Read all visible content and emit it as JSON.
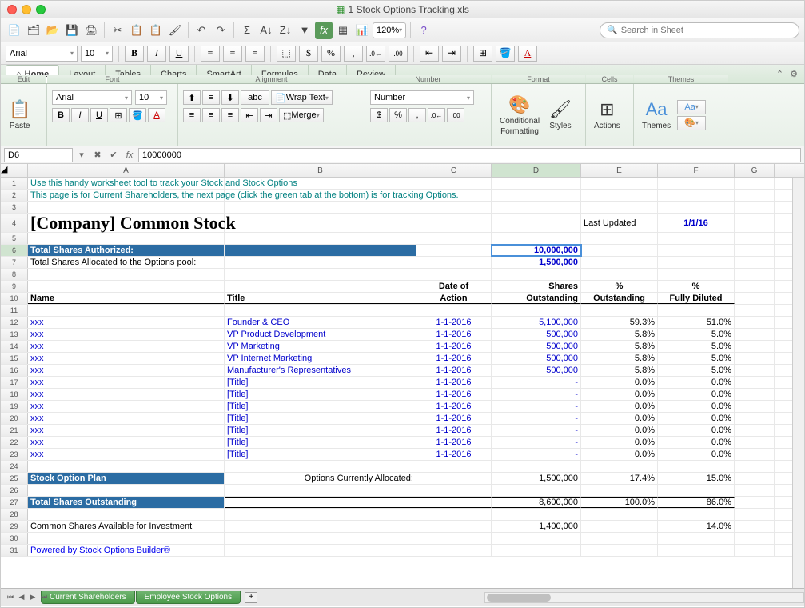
{
  "window": {
    "title": "1 Stock Options Tracking.xls"
  },
  "toolbar1": {
    "zoom": "120%",
    "search_placeholder": "Search in Sheet"
  },
  "toolbar2": {
    "font": "Arial",
    "size": "10"
  },
  "ribbon": {
    "tabs": [
      "Home",
      "Layout",
      "Tables",
      "Charts",
      "SmartArt",
      "Formulas",
      "Data",
      "Review"
    ],
    "groups": {
      "edit": "Edit",
      "font": "Font",
      "alignment": "Alignment",
      "number": "Number",
      "format": "Format",
      "cells": "Cells",
      "themes": "Themes"
    },
    "font_name": "Arial",
    "font_size": "10",
    "wrap_text": "Wrap Text",
    "merge": "Merge",
    "number_format": "Number",
    "cond_fmt": "Conditional",
    "cond_fmt2": "Formatting",
    "styles": "Styles",
    "actions": "Actions",
    "themes_btn": "Themes",
    "aa": "Aa",
    "paste": "Paste"
  },
  "formula": {
    "cell_ref": "D6",
    "value": "10000000"
  },
  "cols": [
    "A",
    "B",
    "C",
    "D",
    "E",
    "F",
    "G"
  ],
  "sheets": {
    "active": "Current Shareholders",
    "other": "Employee Stock Options"
  },
  "cells": {
    "r1": "Use this handy worksheet tool to track your Stock and Stock Options",
    "r2": "This page is for Current Shareholders, the next page (click the green tab at the bottom) is for tracking Options.",
    "r4_title": "[Company] Common Stock",
    "r4_lu": "Last Updated",
    "r4_date": "1/1/16",
    "r6_a": "Total Shares Authorized:",
    "r6_d": "10,000,000",
    "r7_a": "Total Shares Allocated to the Options pool:",
    "r7_d": "1,500,000",
    "r9_c": "Date of",
    "r9_d": "Shares",
    "r9_e": "%",
    "r9_f": "%",
    "r10_a": "Name",
    "r10_b": "Title",
    "r10_c": "Action",
    "r10_d": "Outstanding",
    "r10_e": "Outstanding",
    "r10_f": "Fully Diluted",
    "rows": [
      {
        "a": "xxx",
        "b": "Founder & CEO",
        "c": "1-1-2016",
        "d": "5,100,000",
        "e": "59.3%",
        "f": "51.0%"
      },
      {
        "a": "xxx",
        "b": "VP Product Development",
        "c": "1-1-2016",
        "d": "500,000",
        "e": "5.8%",
        "f": "5.0%"
      },
      {
        "a": "xxx",
        "b": "VP Marketing",
        "c": "1-1-2016",
        "d": "500,000",
        "e": "5.8%",
        "f": "5.0%"
      },
      {
        "a": "xxx",
        "b": "VP Internet Marketing",
        "c": "1-1-2016",
        "d": "500,000",
        "e": "5.8%",
        "f": "5.0%"
      },
      {
        "a": "xxx",
        "b": "Manufacturer's Representatives",
        "c": "1-1-2016",
        "d": "500,000",
        "e": "5.8%",
        "f": "5.0%"
      },
      {
        "a": "xxx",
        "b": "[Title]",
        "c": "1-1-2016",
        "d": "-",
        "e": "0.0%",
        "f": "0.0%"
      },
      {
        "a": "xxx",
        "b": "[Title]",
        "c": "1-1-2016",
        "d": "-",
        "e": "0.0%",
        "f": "0.0%"
      },
      {
        "a": "xxx",
        "b": "[Title]",
        "c": "1-1-2016",
        "d": "-",
        "e": "0.0%",
        "f": "0.0%"
      },
      {
        "a": "xxx",
        "b": "[Title]",
        "c": "1-1-2016",
        "d": "-",
        "e": "0.0%",
        "f": "0.0%"
      },
      {
        "a": "xxx",
        "b": "[Title]",
        "c": "1-1-2016",
        "d": "-",
        "e": "0.0%",
        "f": "0.0%"
      },
      {
        "a": "xxx",
        "b": "[Title]",
        "c": "1-1-2016",
        "d": "-",
        "e": "0.0%",
        "f": "0.0%"
      },
      {
        "a": "xxx",
        "b": "[Title]",
        "c": "1-1-2016",
        "d": "-",
        "e": "0.0%",
        "f": "0.0%"
      }
    ],
    "r25_a": "Stock Option Plan",
    "r25_b": "Options Currently Allocated:",
    "r25_d": "1,500,000",
    "r25_e": "17.4%",
    "r25_f": "15.0%",
    "r27_a": "Total Shares Outstanding",
    "r27_d": "8,600,000",
    "r27_e": "100.0%",
    "r27_f": "86.0%",
    "r29_a": "Common Shares Available for Investment",
    "r29_d": "1,400,000",
    "r29_f": "14.0%",
    "r31_a": "Powered by Stock Options Builder®"
  }
}
